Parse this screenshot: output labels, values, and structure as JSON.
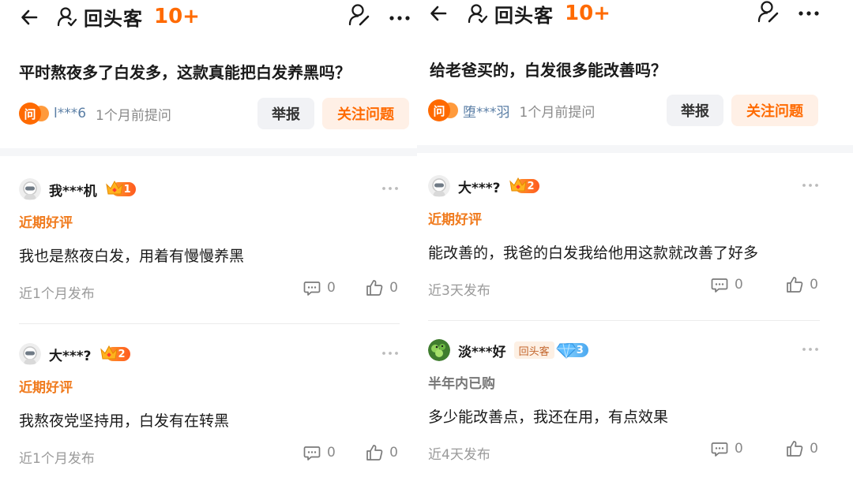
{
  "left": {
    "nav": {
      "title": "回头客",
      "count": "10+"
    },
    "question": {
      "text": "平时熬夜多了白发多，这款真能把白发养黑吗？",
      "asker_badge": "问",
      "asker_name": "l***6",
      "asker_time": "1个月前提问",
      "report_label": "举报",
      "follow_label": "关注问题"
    },
    "answers": [
      {
        "user": "我***机",
        "level": "1",
        "tag": "近期好评",
        "text": "我也是熬夜白发，用着有慢慢养黑",
        "time": "近1个月发布",
        "comments": "0",
        "likes": "0"
      },
      {
        "user": "大***?",
        "level": "2",
        "tag": "近期好评",
        "text": "我熬夜党坚持用，白发有在转黑",
        "time": "近1个月发布",
        "comments": "0",
        "likes": "0"
      }
    ]
  },
  "right": {
    "nav": {
      "title": "回头客",
      "count": "10+"
    },
    "question": {
      "text": "给老爸买的，白发很多能改善吗？",
      "asker_badge": "问",
      "asker_name": "堕***羽",
      "asker_time": "1个月前提问",
      "report_label": "举报",
      "follow_label": "关注问题"
    },
    "answers": [
      {
        "user": "大***?",
        "level": "2",
        "tag": "近期好评",
        "text": "能改善的，我爸的白发我给他用这款就改善了好多",
        "time": "近3天发布",
        "comments": "0",
        "likes": "0"
      },
      {
        "user": "淡***好",
        "repeat_tag": "回头客",
        "diamond_level": "3",
        "tag": "半年内已购",
        "text": "多少能改善点，我还在用，有点效果",
        "time": "近4天发布",
        "comments": "0",
        "likes": "0"
      }
    ]
  },
  "colors": {
    "accent": "#ff6a00",
    "tag_recent": "#f07b1e",
    "tag_bought": "#777777",
    "link_name": "#5a7ea5"
  },
  "icons": [
    "back-arrow-icon",
    "person-icon",
    "user-edit-icon",
    "more-dots-icon",
    "crown-icon",
    "diamond-icon",
    "comment-icon",
    "thumbs-up-icon"
  ]
}
